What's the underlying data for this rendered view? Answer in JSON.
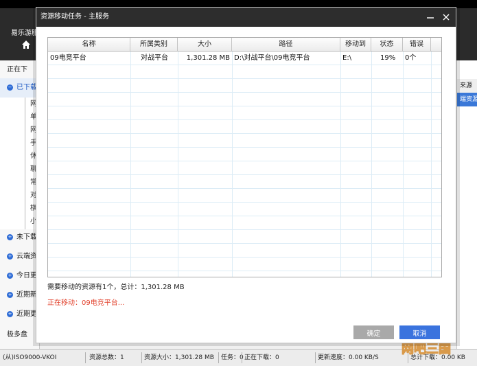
{
  "app": {
    "title": "易乐游服",
    "sidebar": {
      "items": [
        {
          "label": "正在下",
          "icon": "none"
        },
        {
          "label": "已下载",
          "icon": "expand-icon"
        }
      ],
      "sub_items": [
        "网",
        "单",
        "网",
        "手",
        "休",
        "聊",
        "常",
        "对",
        "棋",
        "小"
      ],
      "more_items": [
        {
          "label": "未下载"
        },
        {
          "label": "云端资"
        },
        {
          "label": "今日更"
        },
        {
          "label": "近期新"
        },
        {
          "label": "近期更"
        },
        {
          "label": "极多盘"
        }
      ]
    },
    "right_panel": {
      "header": "来源",
      "row1": "端资源"
    },
    "status_bar": {
      "left": "(从)ISO9000-VKOI",
      "total_resources": "资源总数：1",
      "resource_size": "资源大小：1,301.28 MB",
      "tasks": "任务：0",
      "downloading": "正在下载：0",
      "update_speed": "更新速度：0.00 KB/S",
      "total_download": "总计下载：0.00 KB"
    },
    "watermark": "网吧三国"
  },
  "dialog": {
    "title": "资源移动任务 - 主服务",
    "columns": [
      "名称",
      "所属类别",
      "大小",
      "路径",
      "移动到",
      "状态",
      "错误"
    ],
    "rows": [
      {
        "name": "09电竞平台",
        "category": "对战平台",
        "size": "1,301.28 MB",
        "path": "D:\\对战平台\\09电竞平台",
        "move_to": "E:\\",
        "status": "19%",
        "error": "0个"
      }
    ],
    "summary": "需要移动的资源有1个，总计：1,301.28 MB",
    "progress_text": "正在移动：09电竞平台...",
    "ok_label": "确定",
    "cancel_label": "取消"
  },
  "colors": {
    "titlebar": "#2d2d2d",
    "accent": "#3a73de",
    "progress_text": "#e2432e",
    "disabled_button": "#a9a9a9"
  }
}
